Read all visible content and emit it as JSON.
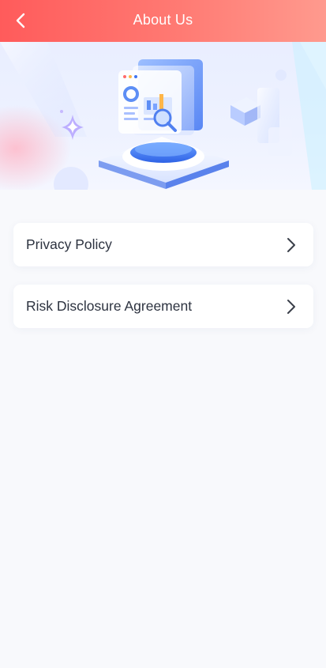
{
  "header": {
    "title": "About Us",
    "back_icon": "chevron-left-icon"
  },
  "banner": {
    "illustration": "data-dashboard-illustration"
  },
  "menu": {
    "items": [
      {
        "label": "Privacy Policy",
        "icon": "chevron-right-icon"
      },
      {
        "label": "Risk Disclosure Agreement",
        "icon": "chevron-right-icon"
      }
    ]
  },
  "colors": {
    "header_gradient_start": "#ff5b5b",
    "header_gradient_end": "#ff9a8e",
    "page_background": "#f8f9fc",
    "card_background": "#ffffff",
    "text_primary": "#2d3340"
  }
}
